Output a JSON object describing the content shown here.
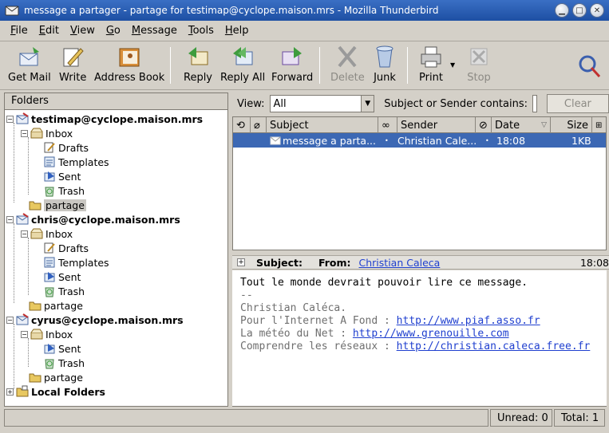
{
  "window": {
    "title": "message a partager - partage for testimap@cyclope.maison.mrs - Mozilla Thunderbird"
  },
  "menubar": [
    "File",
    "Edit",
    "View",
    "Go",
    "Message",
    "Tools",
    "Help"
  ],
  "toolbar": {
    "get_mail": "Get Mail",
    "write": "Write",
    "address_book": "Address Book",
    "reply": "Reply",
    "reply_all": "Reply All",
    "forward": "Forward",
    "delete": "Delete",
    "junk": "Junk",
    "print": "Print",
    "stop": "Stop"
  },
  "folders": {
    "header": "Folders",
    "accounts": [
      {
        "name": "testimap@cyclope.maison.mrs",
        "inbox": "Inbox",
        "sub": [
          "Drafts",
          "Templates",
          "Sent",
          "Trash"
        ],
        "extra": "partage"
      },
      {
        "name": "chris@cyclope.maison.mrs",
        "inbox": "Inbox",
        "sub": [
          "Drafts",
          "Templates",
          "Sent",
          "Trash"
        ],
        "extra": "partage"
      },
      {
        "name": "cyrus@cyclope.maison.mrs",
        "inbox": "Inbox",
        "sub": [
          "Sent",
          "Trash"
        ],
        "extra": "partage"
      }
    ],
    "local": "Local Folders"
  },
  "viewbar": {
    "view_label": "View:",
    "view_value": "All",
    "search_label": "Subject or Sender contains:",
    "clear_label": "Clear"
  },
  "thread": {
    "columns": {
      "subject": "Subject",
      "sender": "Sender",
      "date": "Date",
      "size": "Size"
    },
    "row": {
      "subject": "message a parta...",
      "sender": "Christian Cale...",
      "date": "18:08",
      "size": "1KB"
    }
  },
  "msg_header": {
    "subject_label": "Subject:",
    "from_label": "From:",
    "from_value": "Christian Caleca",
    "time": "18:08"
  },
  "msg_body": {
    "line1": "Tout le monde devrait pouvoir lire ce message.",
    "sep": "--",
    "sig_name": "Christian Caléca.",
    "sig1_text": "Pour l'Internet A Fond : ",
    "sig1_link": "http://www.piaf.asso.fr",
    "sig2_text": "La météo du Net : ",
    "sig2_link": "http://www.grenouille.com",
    "sig3_text": "Comprendre les réseaux : ",
    "sig3_link": "http://christian.caleca.free.fr"
  },
  "status": {
    "unread": "Unread: 0",
    "total": "Total: 1"
  }
}
